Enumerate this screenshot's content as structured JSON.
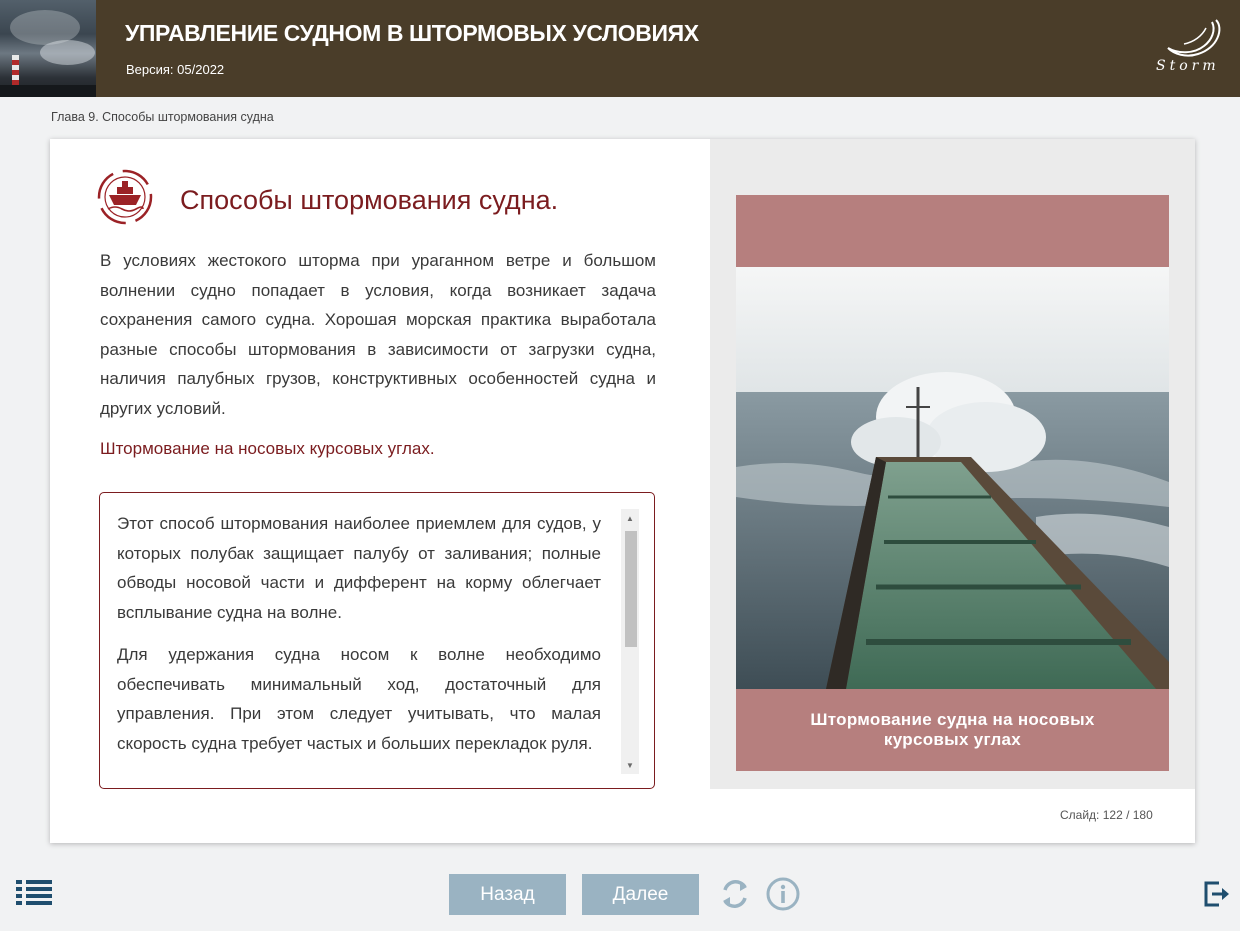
{
  "header": {
    "title": "УПРАВЛЕНИЕ СУДНОМ В ШТОРМОВЫХ УСЛОВИЯХ",
    "version": "Версия: 05/2022",
    "logo_text": "Storm"
  },
  "breadcrumb": "Глава 9. Способы штормования судна",
  "content": {
    "heading": "Способы штормования судна.",
    "paragraph": "В условиях жестокого шторма при ураганном ветре и большом волнении судно попадает в условия, когда возникает задача сохранения самого судна. Хорошая морская практика выработала разные способы штормования в зависимости от загрузки судна, наличия палубных грузов, конструктивных особенностей судна и других условий.",
    "subheading": "Штормование на носовых курсовых углах.",
    "scroll_paragraphs": [
      "Этот способ штормования наиболее приемлем для судов, у которых полубак защищает палубу от заливания; полные обводы носовой части и дифферент на корму облегчает всплывание судна на волне.",
      "Для удержания судна носом к волне необходимо обеспечивать минимальный ход, достаточный для управления. При этом следует учитывать, что малая скорость судна требует частых и больших перекладок руля."
    ]
  },
  "figure": {
    "caption": "Штормование судна на носовых курсовых углах"
  },
  "slide_counter": "Слайд:  122 / 180",
  "nav": {
    "back_label": "Назад",
    "next_label": "Далее"
  },
  "icons": {
    "menu": "list-menu-icon",
    "refresh": "refresh-icon",
    "info": "info-icon",
    "exit": "exit-icon",
    "chapter": "ship-wheel-icon"
  },
  "colors": {
    "header_bg": "#4a3d29",
    "accent": "#7b1c1f",
    "caption_bg": "#b67f7e",
    "button_bg": "#9ab3c2"
  }
}
